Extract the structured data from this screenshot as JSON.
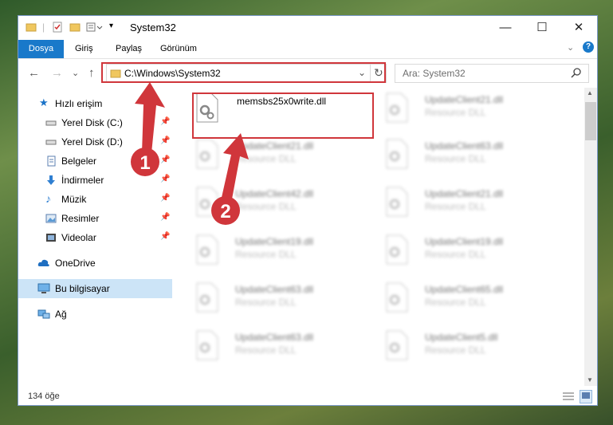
{
  "titlebar": {
    "title": "System32",
    "quick_access_icons": [
      "folder-icon",
      "properties-icon",
      "new-folder-icon",
      "customize-icon"
    ],
    "minimize": "—",
    "maximize": "☐",
    "close": "✕"
  },
  "ribbon": {
    "tabs": [
      {
        "label": "Dosya",
        "active": true
      },
      {
        "label": "Giriş",
        "active": false
      },
      {
        "label": "Paylaş",
        "active": false
      },
      {
        "label": "Görünüm",
        "active": false
      }
    ]
  },
  "navbar": {
    "back": "←",
    "forward": "→",
    "recent": "⌄",
    "up": "↑",
    "address": "C:\\Windows\\System32",
    "refresh": "↻",
    "search_placeholder": "Ara: System32"
  },
  "sidebar": {
    "items": [
      {
        "label": "Hızlı erişim",
        "icon": "star-icon",
        "pinned": false
      },
      {
        "label": "Yerel Disk (C:)",
        "icon": "drive-icon",
        "pinned": true
      },
      {
        "label": "Yerel Disk (D:)",
        "icon": "drive-icon",
        "pinned": true
      },
      {
        "label": "Belgeler",
        "icon": "documents-icon",
        "pinned": true
      },
      {
        "label": "İndirmeler",
        "icon": "download-icon",
        "pinned": true
      },
      {
        "label": "Müzik",
        "icon": "music-icon",
        "pinned": true
      },
      {
        "label": "Resimler",
        "icon": "pictures-icon",
        "pinned": true
      },
      {
        "label": "Videolar",
        "icon": "videos-icon",
        "pinned": true
      },
      {
        "label": "OneDrive",
        "icon": "cloud-icon",
        "pinned": false
      },
      {
        "label": "Bu bilgisayar",
        "icon": "computer-icon",
        "pinned": false,
        "selected": true
      },
      {
        "label": "Ağ",
        "icon": "network-icon",
        "pinned": false
      }
    ]
  },
  "files": {
    "highlighted": {
      "name": "memsbs25x0write.dll"
    },
    "col1": [
      {
        "name": "UpdateClient21.dll",
        "type": "Resource DLL"
      },
      {
        "name": "UpdateClient42.dll",
        "type": "Resource DLL"
      },
      {
        "name": "UpdateClient19.dll",
        "type": "Resource DLL"
      },
      {
        "name": "UpdateClient63.dll",
        "type": "Resource DLL"
      },
      {
        "name": "UpdateClient63.dll",
        "type": "Resource DLL"
      }
    ],
    "col2": [
      {
        "name": "UpdateClient21.dll",
        "type": "Resource DLL"
      },
      {
        "name": "UpdateClient63.dll",
        "type": "Resource DLL"
      },
      {
        "name": "UpdateClient21.dll",
        "type": "Resource DLL"
      },
      {
        "name": "UpdateClient19.dll",
        "type": "Resource DLL"
      },
      {
        "name": "UpdateClient65.dll",
        "type": "Resource DLL"
      },
      {
        "name": "UpdateClient5.dll",
        "type": "Resource DLL"
      }
    ]
  },
  "status": {
    "item_count": "134 öğe"
  },
  "annotations": {
    "step1": "1",
    "step2": "2",
    "color": "#d0363b"
  }
}
